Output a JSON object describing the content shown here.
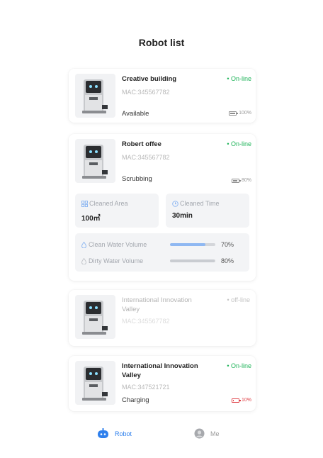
{
  "header": {
    "title": "Robot list"
  },
  "robots": [
    {
      "name": "Creative building",
      "connection": "On-line",
      "mac": "MAC:345567782",
      "status": "Available",
      "battery_text": "100%",
      "battery_level": 1.0
    },
    {
      "name": "Robert offee",
      "connection": "On-line",
      "mac": "MAC:345567782",
      "status": "Scrubbing",
      "battery_text": "80%",
      "battery_level": 0.8,
      "cleaned_area_label": "Cleaned Area",
      "cleaned_area_value": "100㎡",
      "cleaned_time_label": "Cleaned Time",
      "cleaned_time_value": "30min",
      "clean_water_label": "Clean Water Volume",
      "clean_water_pct": "70%",
      "clean_water_level": 0.78,
      "dirty_water_label": "Dirty Water Volume",
      "dirty_water_pct": "80%",
      "dirty_water_level": 0.98
    },
    {
      "name": "International Innovation Valley",
      "connection": "off-line",
      "mac": "MAC:345567782"
    },
    {
      "name": "International Innovation Valley",
      "connection": "On-line",
      "mac": "MAC:347521721",
      "status": "Charging",
      "battery_text": "10%",
      "battery_level": 0.1
    }
  ],
  "tabbar": {
    "robot_label": "Robot",
    "me_label": "Me"
  },
  "colors": {
    "online": "#20b45a",
    "accent": "#2f80ed",
    "low_battery": "#e0444a",
    "clean_water_bar": "#8fb8f2",
    "dirty_water_bar": "#c9ccd1"
  },
  "icons": {
    "robot_tab": "robot-face-icon",
    "me_tab": "avatar-icon",
    "battery": "battery-icon",
    "area": "grid-area-icon",
    "time": "clock-icon",
    "water": "water-drop-icon"
  }
}
